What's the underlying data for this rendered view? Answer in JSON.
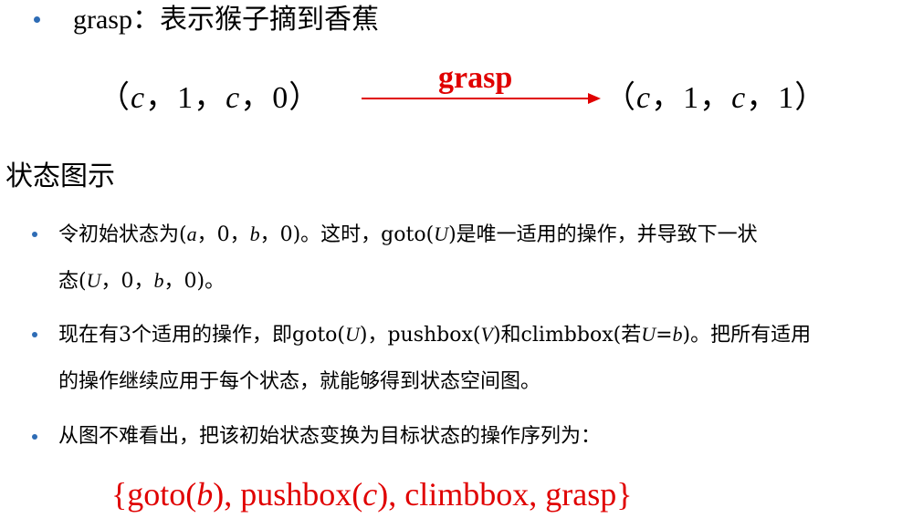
{
  "top_bullet": {
    "keyword": "grasp",
    "separator": "：",
    "description": "表示猴子摘到香蕉"
  },
  "transition": {
    "from_open": "（",
    "from_c1": "c",
    "from_sep1": "，",
    "from_n1": "1",
    "from_sep2": "，",
    "from_c2": "c",
    "from_sep3": "，",
    "from_n2": "0",
    "from_close": "）",
    "operator": "grasp",
    "to_open": "（",
    "to_c1": "c",
    "to_sep1": "，",
    "to_n1": "1",
    "to_sep2": "，",
    "to_c2": "c",
    "to_sep3": "，",
    "to_n2": "1",
    "to_close": "）"
  },
  "heading": "状态图示",
  "bullets": {
    "b1": {
      "p1": "令初始状态为(",
      "a": "a",
      "p2": "，0，",
      "b": "b",
      "p3": "，0)。这时，goto(",
      "U": "U",
      "p4": ")是唯一适用的操作，并导致下一状",
      "l2a": "态(",
      "l2U": "U",
      "l2b": "，0，",
      "l2bv": "b",
      "l2c": "，0)。"
    },
    "b2": {
      "p1": "现在有3个适用的操作，即goto(",
      "U": "U",
      "p2": ")，pushbox(",
      "V": "V",
      "p3": ")和climbbox(若",
      "U2": "U",
      "eq": "=",
      "b": "b",
      "p4": ")。把所有适用",
      "l2": "的操作继续应用于每个状态，就能够得到状态空间图。"
    },
    "b3": {
      "text": "从图不难看出，把该初始状态变换为目标状态的操作序列为："
    }
  },
  "sequence": {
    "p1": "{goto(",
    "b": "b",
    "p2": "), pushbox(",
    "c": "c",
    "p3": "), climbbox, grasp}"
  },
  "colors": {
    "bullet": "#2e6cb5",
    "accent_red": "#e00000"
  }
}
